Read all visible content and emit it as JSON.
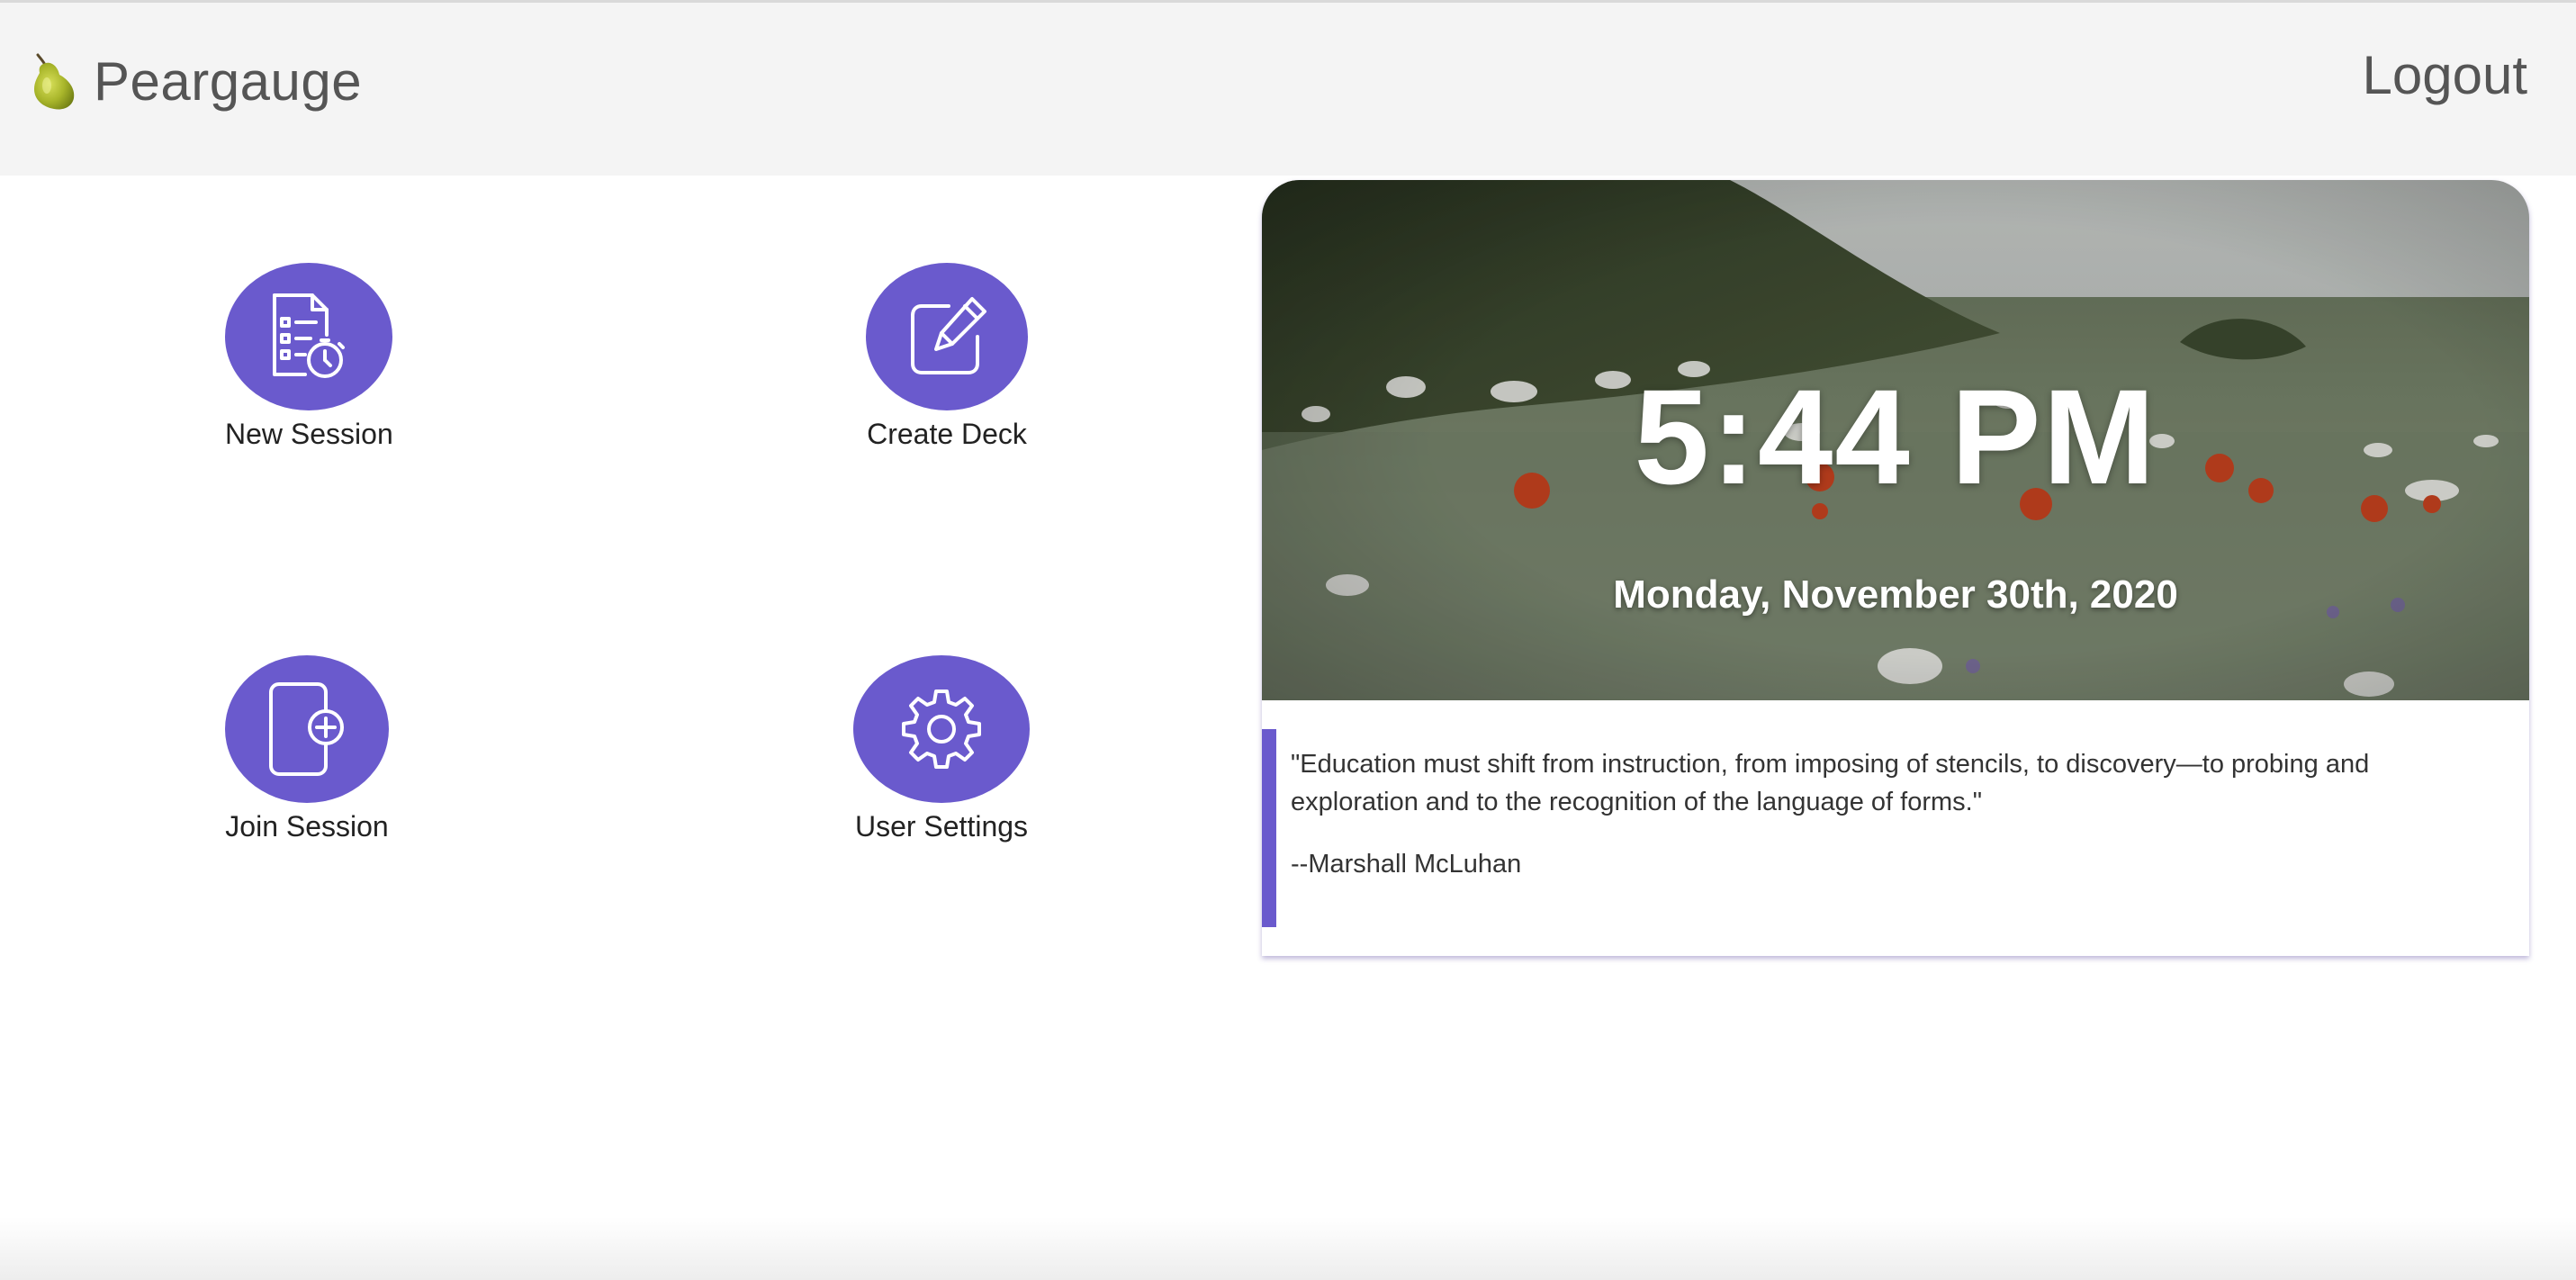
{
  "app": {
    "logo_icon": "pear-icon",
    "name": "Peargauge"
  },
  "navbar": {
    "logout_label": "Logout"
  },
  "menu": {
    "accent_color": "#6a5acd",
    "items": [
      {
        "label": "New Session",
        "icon": "session-checklist-timer-icon"
      },
      {
        "label": "Create Deck",
        "icon": "edit-square-pen-icon"
      },
      {
        "label": "Join Session",
        "icon": "join-document-plus-icon"
      },
      {
        "label": "User Settings",
        "icon": "gear-icon"
      }
    ]
  },
  "dashboard": {
    "time": "5:44 PM",
    "date": "Monday, November 30th, 2020",
    "background_image": "wildflower-meadow-photo",
    "quote": {
      "text": "\"Education must shift from instruction, from imposing of stencils, to discovery—to probing and exploration and to the recognition of the language of forms.\"",
      "author": "--Marshall McLuhan"
    }
  }
}
